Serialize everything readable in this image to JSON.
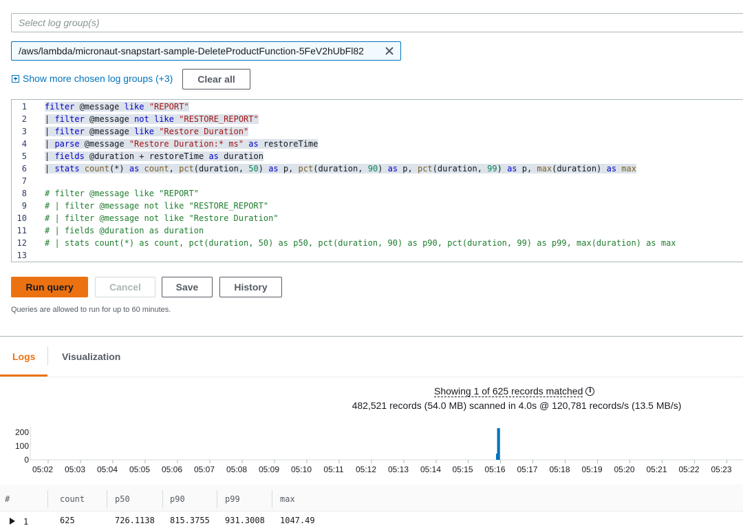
{
  "log_group_select": {
    "placeholder": "Select log group(s)"
  },
  "selected_group": {
    "label": "/aws/lambda/micronaut-snapstart-sample-DeleteProductFunction-5FeV2hUbFl82"
  },
  "show_more": {
    "label": "Show more chosen log groups (+3)"
  },
  "clear_all": {
    "label": "Clear all"
  },
  "editor": {
    "line_numbers": [
      "1",
      "2",
      "3",
      "4",
      "5",
      "6",
      "7",
      "8",
      "9",
      "10",
      "11",
      "12",
      "13"
    ],
    "lines": [
      "filter @message like \"REPORT\"",
      "| filter @message not like \"RESTORE_REPORT\"",
      "| filter @message like \"Restore Duration\"",
      "| parse @message \"Restore Duration:* ms\" as restoreTime",
      "| fields @duration + restoreTime as duration",
      "| stats count(*) as count, pct(duration, 50) as p50, pct(duration, 90) as p90, pct(duration, 99) as p99, max(duration) as max",
      "",
      "# filter @message like \"REPORT\"",
      "# | filter @message not like \"RESTORE_REPORT\"",
      "# | filter @message not like \"Restore Duration\"",
      "# | fields @duration as duration",
      "# | stats count(*) as count, pct(duration, 50) as p50, pct(duration, 90) as p90, pct(duration, 99) as p99, max(duration) as max",
      ""
    ]
  },
  "buttons": {
    "run": "Run query",
    "cancel": "Cancel",
    "save": "Save",
    "history": "History"
  },
  "note": "Queries are allowed to run for up to 60 minutes.",
  "tabs": {
    "logs": "Logs",
    "visualization": "Visualization"
  },
  "status": {
    "showing": "Showing 1 of 625 records matched",
    "scanned": "482,521 records (54.0 MB) scanned in 4.0s @ 120,781 records/s (13.5 MB/s)"
  },
  "chart_data": {
    "type": "bar",
    "y_ticks": [
      "200",
      "100",
      "0"
    ],
    "x_ticks": [
      "05:02",
      "05:03",
      "05:04",
      "05:05",
      "05:06",
      "05:07",
      "05:08",
      "05:09",
      "05:10",
      "05:11",
      "05:12",
      "05:13",
      "05:14",
      "05:15",
      "05:16",
      "05:17",
      "05:18",
      "05:19",
      "05:20",
      "05:21",
      "05:22",
      "05:23"
    ],
    "ylim": [
      0,
      250
    ],
    "bar_color": "#0073bb",
    "bars": [
      {
        "time": "05:15:53",
        "value": 45
      },
      {
        "time": "05:15:55",
        "value": 250
      },
      {
        "time": "05:15:57",
        "value": 270
      }
    ]
  },
  "table": {
    "headers": [
      "#",
      "count",
      "p50",
      "p90",
      "p99",
      "max"
    ],
    "rows": [
      [
        "1",
        "625",
        "726.1138",
        "815.3755",
        "931.3008",
        "1047.49"
      ]
    ]
  },
  "colors": {
    "accent": "#ec7211",
    "link": "#0073bb",
    "comment": "#1e7d2e"
  }
}
